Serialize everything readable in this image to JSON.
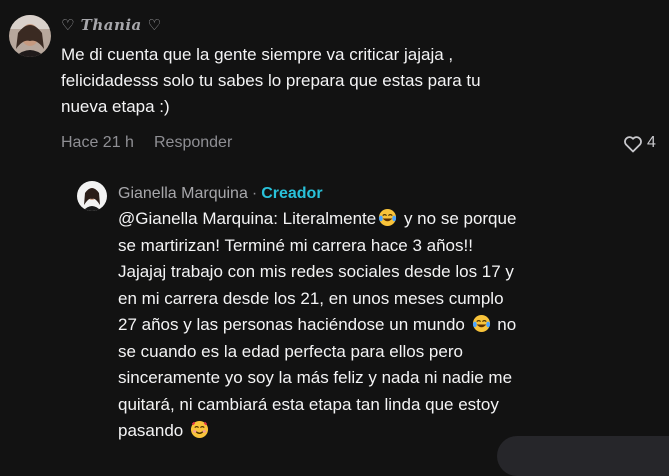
{
  "comment": {
    "username": "♡ Thania ♡",
    "lines": [
      "Me di cuenta que la gente siempre va criticar jajaja ,",
      "felicidadesss solo tu sabes lo prepara que estas para tu",
      "nueva etapa :)"
    ],
    "time": "Hace 21 h",
    "reply_label": "Responder",
    "likes": "4"
  },
  "reply": {
    "author": "Gianella Marquina",
    "separator": "·",
    "badge": "Creador",
    "lines": {
      "l1a": "@Gianella Marquina: Literalmente",
      "l1b": " y no se porque",
      "l2": "se martirizan! Terminé mi carrera hace 3 años!!",
      "l3": "Jajajaj trabajo con mis redes sociales desde los 17 y",
      "l4": "en mi carrera desde los 21, en unos meses cumplo",
      "l5a": "27 años y las personas haciéndose un mundo ",
      "l5b": " no",
      "l6": "se cuando es la edad perfecta para ellos pero",
      "l7": "sinceramente yo soy la más feliz y nada ni nadie me",
      "l8": "quitará, ni cambiará esta etapa tan linda que estoy",
      "l9": "pasando "
    },
    "emojis": [
      "tears-of-joy-emoji",
      "tears-of-joy-emoji",
      "smiling-face-with-hearts-emoji"
    ]
  },
  "colors": {
    "background": "#121212",
    "text": "#f4f4f5",
    "muted": "#8f8f94",
    "creator_badge": "#29c2da"
  },
  "icons": {
    "like": "heart-outline-icon"
  }
}
